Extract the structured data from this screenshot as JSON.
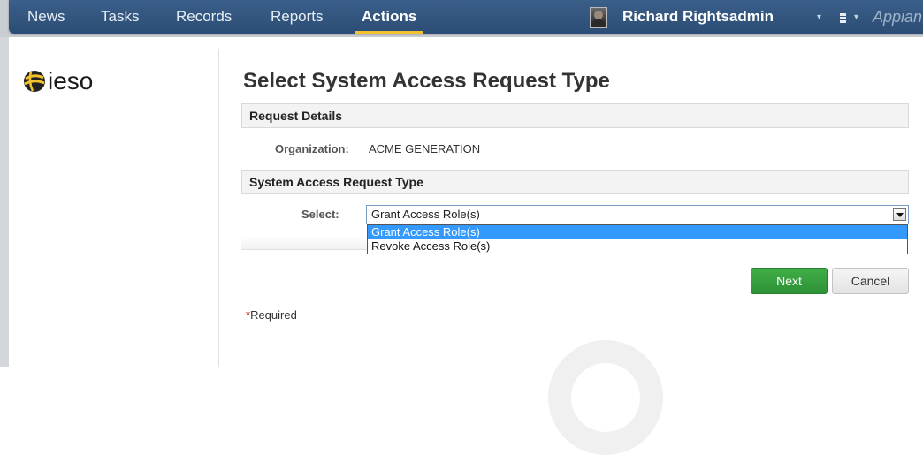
{
  "nav": {
    "items": [
      {
        "label": "News"
      },
      {
        "label": "Tasks"
      },
      {
        "label": "Records"
      },
      {
        "label": "Reports"
      },
      {
        "label": "Actions",
        "active": true
      }
    ],
    "user_name": "Richard Rightsadmin",
    "brand": "Appian",
    "accent_color": "#f2c12e"
  },
  "sidebar": {
    "logo_text": "ieso"
  },
  "main": {
    "page_title": "Select System Access Request Type",
    "request_details": {
      "header": "Request Details",
      "organization_label": "Organization:",
      "organization_value": "ACME GENERATION"
    },
    "request_type": {
      "header": "System Access Request Type",
      "select_label": "Select:",
      "selected_value": "Grant Access Role(s)",
      "options": [
        "Grant Access Role(s)",
        "Revoke Access Role(s)"
      ]
    },
    "buttons": {
      "next": "Next",
      "cancel": "Cancel"
    },
    "required_note": "Required",
    "required_star": "*"
  }
}
